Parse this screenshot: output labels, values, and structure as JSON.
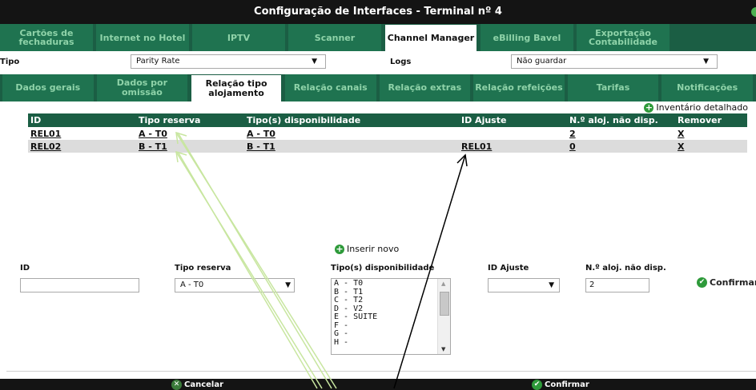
{
  "window": {
    "title": "Configuração de Interfaces - Terminal nº 4"
  },
  "tabs_main": [
    {
      "label": "Cartões de fechaduras"
    },
    {
      "label": "Internet no Hotel"
    },
    {
      "label": "IPTV"
    },
    {
      "label": "Scanner"
    },
    {
      "label": "Channel Manager",
      "active": true
    },
    {
      "label": "eBilling Bavel"
    },
    {
      "label": "Exportação Contabilidade"
    }
  ],
  "settings": {
    "tipo_label": "Tipo",
    "tipo_value": "Parity Rate",
    "logs_label": "Logs",
    "logs_value": "Não guardar"
  },
  "tabs_sub": [
    {
      "label": "Dados gerais"
    },
    {
      "label": "Dados por omissão"
    },
    {
      "label": "Relação tipo alojamento",
      "active": true
    },
    {
      "label": "Relação canais"
    },
    {
      "label": "Relação extras"
    },
    {
      "label": "Relação refeições"
    },
    {
      "label": "Tarifas"
    },
    {
      "label": "Notificações"
    }
  ],
  "inventory_link": "Inventário detalhado",
  "table": {
    "headers": [
      "ID",
      "Tipo reserva",
      "Tipo(s) disponibilidade",
      "ID Ajuste",
      "N.º aloj. não disp.",
      "Remover"
    ],
    "rows": [
      [
        "REL01",
        "A - T0",
        "A - T0",
        "",
        "2",
        "X"
      ],
      [
        "REL02",
        "B - T1",
        "B - T1",
        "REL01",
        "0",
        "X"
      ]
    ]
  },
  "insert_new": "Inserir novo",
  "form": {
    "id_label": "ID",
    "id_value": "",
    "tipo_reserva_label": "Tipo reserva",
    "tipo_reserva_value": "A - T0",
    "tipo_disp_label": "Tipo(s) disponibilidade",
    "tipo_disp_options": [
      "A - T0",
      "B - T1",
      "C - T2",
      "D - V2",
      "E - SUITE",
      "F -",
      "G -",
      "H -"
    ],
    "id_ajuste_label": "ID Ajuste",
    "id_ajuste_value": "",
    "n_aloj_label": "N.º aloj. não disp.",
    "n_aloj_value": "2",
    "confirm_label": "Confirmar"
  },
  "footer": {
    "cancel": "Cancelar",
    "confirm": "Confirmar"
  },
  "colors": {
    "tab_bg": "#1b5e44",
    "tab_text": "#8fd3a9",
    "accent_green": "#2e9a3a",
    "titlebar": "#141414"
  }
}
